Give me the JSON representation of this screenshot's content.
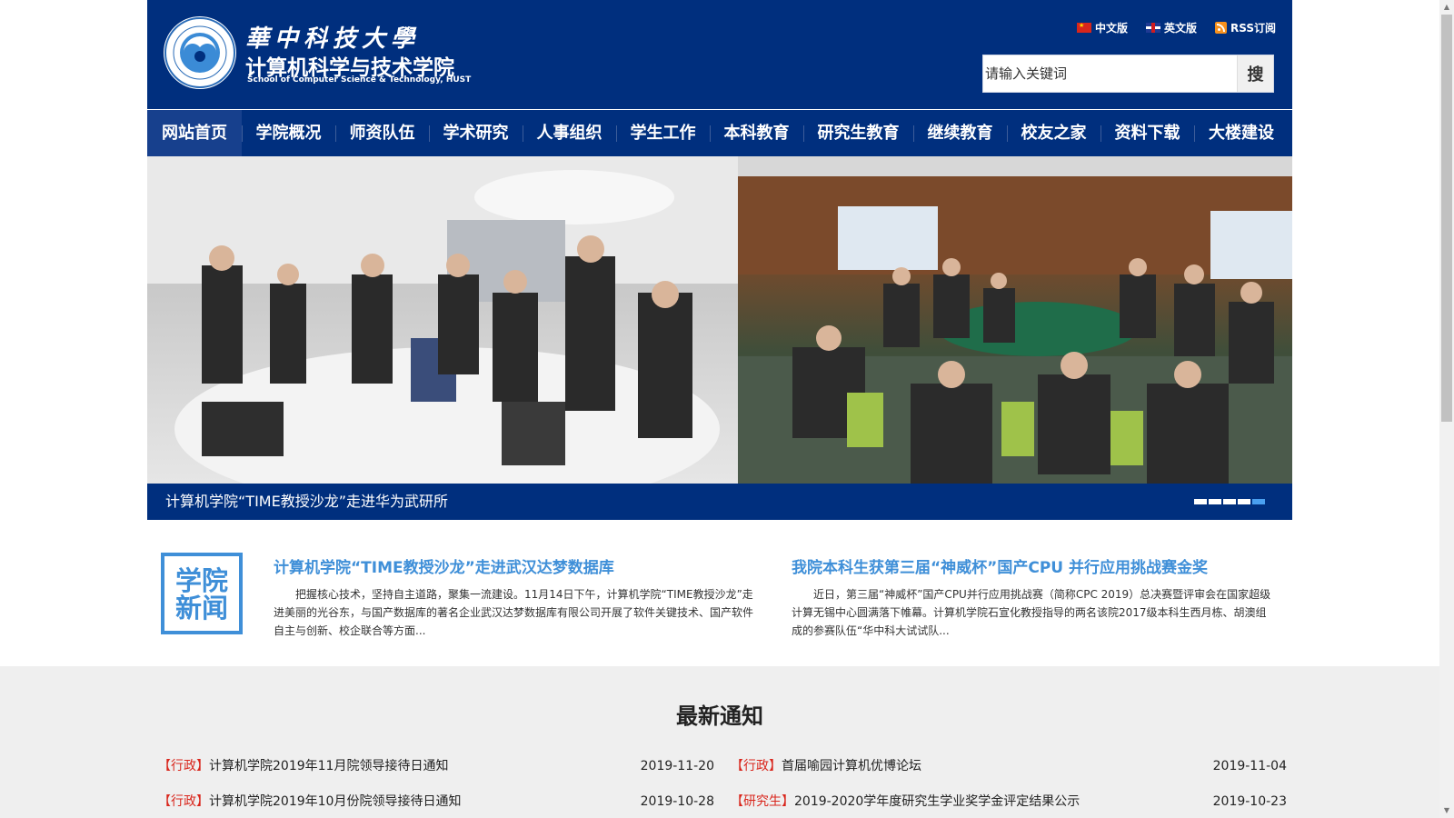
{
  "header": {
    "school_cn_hust": "華中科技大學",
    "school_cn": "计算机科学与技术学院",
    "school_en": "School of Computer Science & Technology, HUST",
    "lang_cn": "中文版",
    "lang_en": "英文版",
    "rss": "RSS订阅",
    "search_placeholder": "请输入关键词",
    "search_button": "搜"
  },
  "nav": [
    {
      "label": "网站首页",
      "active": true
    },
    {
      "label": "学院概况"
    },
    {
      "label": "师资队伍"
    },
    {
      "label": "学术研究"
    },
    {
      "label": "人事组织"
    },
    {
      "label": "学生工作"
    },
    {
      "label": "本科教育"
    },
    {
      "label": "研究生教育"
    },
    {
      "label": "继续教育"
    },
    {
      "label": "校友之家"
    },
    {
      "label": "资料下载"
    },
    {
      "label": "大楼建设"
    }
  ],
  "banner": {
    "caption": "计算机学院“TIME教授沙龙”走进华为武研所",
    "slide_count": 5,
    "active_slide": 4
  },
  "news": {
    "badge": "学院新闻",
    "items": [
      {
        "title": "计算机学院“TIME教授沙龙”走进武汉达梦数据库",
        "summary": "把握核心技术，坚持自主道路，聚集一流建设。11月14日下午，计算机学院“TIME教授沙龙”走进美丽的光谷东，与国产数据库的著名企业武汉达梦数据库有限公司开展了软件关键技术、国产软件自主与创新、校企联合等方面..."
      },
      {
        "title": "我院本科生获第三届“神威杯”国产CPU 并行应用挑战赛金奖",
        "summary": "近日，第三届“神威杯”国产CPU并行应用挑战赛（简称CPC 2019）总决赛暨评审会在国家超级计算无锡中心圆满落下帷幕。计算机学院石宣化教授指导的两名该院2017级本科生西月栋、胡澳组成的参赛队伍“华中科大试试队..."
      }
    ]
  },
  "notices": {
    "heading": "最新通知",
    "items": [
      {
        "category": "【行政】",
        "title": "计算机学院2019年11月院领导接待日通知",
        "date": "2019-11-20"
      },
      {
        "category": "【行政】",
        "title": "首届喻园计算机优博论坛",
        "date": "2019-11-04"
      },
      {
        "category": "【行政】",
        "title": "计算机学院2019年10月份院领导接待日通知",
        "date": "2019-10-28"
      },
      {
        "category": "【研究生】",
        "title": "2019-2020学年度研究生学业奖学金评定结果公示",
        "date": "2019-10-23"
      }
    ]
  },
  "colors": {
    "header_blue": "#002f7e",
    "nav_active": "#17408d",
    "news_blue": "#3f8fd8",
    "notice_category_red": "#d9261c",
    "gray_band": "#efefef"
  },
  "icons": [
    "hust-seal-logo",
    "china-flag-icon",
    "uk-flag-icon",
    "rss-icon",
    "search-button"
  ]
}
